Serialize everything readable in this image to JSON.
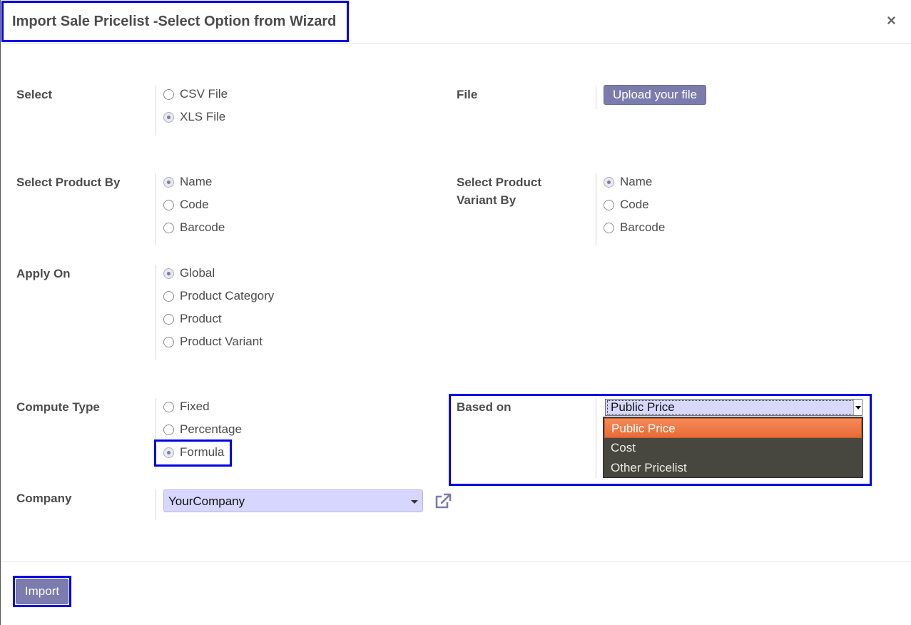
{
  "dialog": {
    "title": "Import Sale Pricelist -Select Option from Wizard",
    "close_label": "×"
  },
  "select": {
    "label": "Select",
    "options": [
      {
        "label": "CSV File",
        "checked": false
      },
      {
        "label": "XLS File",
        "checked": true
      }
    ]
  },
  "file": {
    "label": "File",
    "button_label": "Upload your file"
  },
  "product_by": {
    "label": "Select Product By",
    "options": [
      {
        "label": "Name",
        "checked": true
      },
      {
        "label": "Code",
        "checked": false
      },
      {
        "label": "Barcode",
        "checked": false
      }
    ]
  },
  "variant_by": {
    "label_line1": "Select Product",
    "label_line2": "Variant By",
    "options": [
      {
        "label": "Name",
        "checked": true
      },
      {
        "label": "Code",
        "checked": false
      },
      {
        "label": "Barcode",
        "checked": false
      }
    ]
  },
  "apply_on": {
    "label": "Apply On",
    "options": [
      {
        "label": "Global",
        "checked": true
      },
      {
        "label": "Product Category",
        "checked": false
      },
      {
        "label": "Product",
        "checked": false
      },
      {
        "label": "Product Variant",
        "checked": false
      }
    ]
  },
  "compute_type": {
    "label": "Compute Type",
    "options": [
      {
        "label": "Fixed",
        "checked": false
      },
      {
        "label": "Percentage",
        "checked": false
      },
      {
        "label": "Formula",
        "checked": true
      }
    ]
  },
  "based_on": {
    "label": "Based on",
    "value": "Public Price",
    "options": [
      "Public Price",
      "Cost",
      "Other Pricelist"
    ],
    "selected_index": 0
  },
  "company": {
    "label": "Company",
    "value": "YourCompany"
  },
  "footer": {
    "import_label": "Import"
  },
  "colors": {
    "primary": "#7c7bad",
    "highlight": "#0000e6",
    "dropdown_bg": "#47463f",
    "dropdown_selected": "#ee7843",
    "select_bg": "#d6d6ff"
  }
}
